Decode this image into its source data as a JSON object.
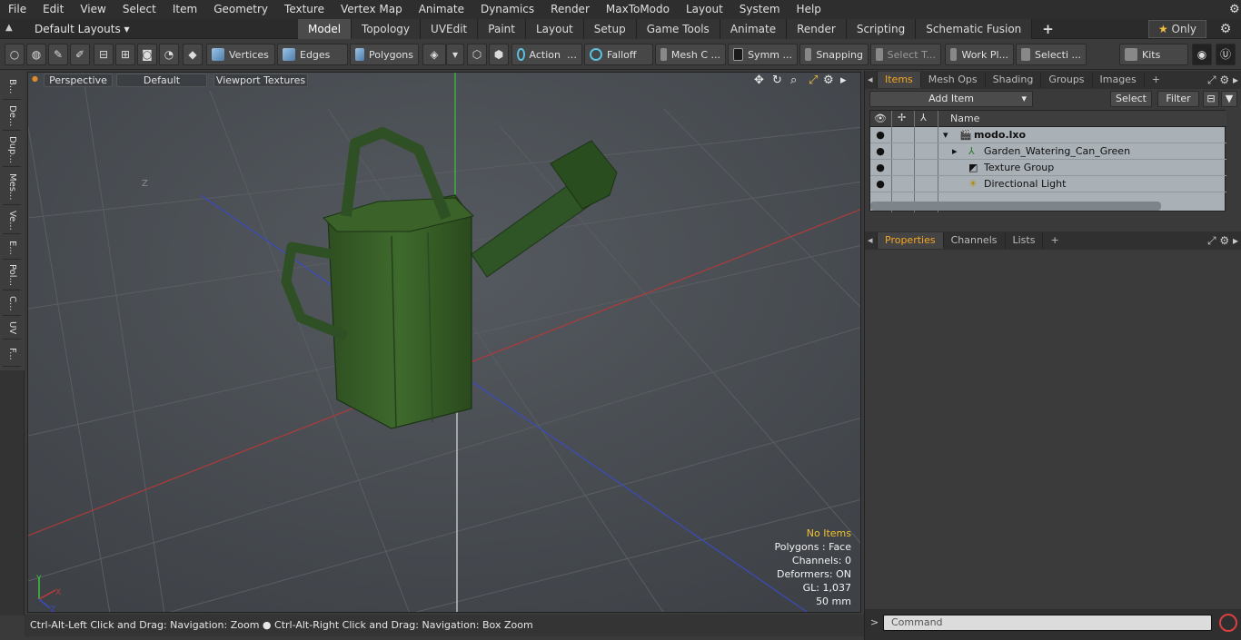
{
  "menubar": {
    "items": [
      "File",
      "Edit",
      "View",
      "Select",
      "Item",
      "Geometry",
      "Texture",
      "Vertex Map",
      "Animate",
      "Dynamics",
      "Render",
      "MaxToModo",
      "Layout",
      "System",
      "Help"
    ]
  },
  "layoutbar": {
    "layout_label": "Default Layouts",
    "tabs": [
      "Model",
      "Topology",
      "UVEdit",
      "Paint",
      "Layout",
      "Setup",
      "Game Tools",
      "Animate",
      "Render",
      "Scripting",
      "Schematic Fusion"
    ],
    "active_tab": "Model",
    "add_tab": "+",
    "only_label": "Only"
  },
  "toolbar": {
    "vertices": "Vertices",
    "edges": "Edges",
    "polygons": "Polygons",
    "action": "Action",
    "falloff": "Falloff",
    "mesh_c": "Mesh C ...",
    "symm": "Symm ...",
    "snapping": "Snapping",
    "select_t": "Select T...",
    "work_pl": "Work Pl...",
    "selecti": "Selecti ...",
    "kits": "Kits"
  },
  "leftstrip": {
    "tabs": [
      "B...",
      "De...",
      "Dup...",
      "Mes...",
      "Ve...",
      "E...",
      "Pol...",
      "C...",
      "UV",
      "F..."
    ]
  },
  "viewport": {
    "view_mode": "Perspective",
    "style": "Default",
    "textures": "Viewport Textures",
    "info": {
      "no_items": "No Items",
      "polygons": "Polygons : Face",
      "channels": "Channels: 0",
      "deformers": "Deformers: ON",
      "gl": "GL: 1,037",
      "size": "50 mm"
    },
    "axis_z_label": "Z",
    "axis_y": "Y",
    "axis_x": "X",
    "axis_z": "Z"
  },
  "statusbar": {
    "left": "Ctrl-Alt-Left Click and Drag: Navigation: Zoom",
    "right": "Ctrl-Alt-Right Click and Drag: Navigation: Box Zoom"
  },
  "items_panel": {
    "tabs": [
      "Items",
      "Mesh Ops",
      "Shading",
      "Groups",
      "Images"
    ],
    "active_tab": "Items",
    "add_item": "Add Item",
    "select_btn": "Select",
    "filter_btn": "Filter",
    "column_name": "Name",
    "rows": [
      {
        "name": "modo.lxo",
        "bold": true
      },
      {
        "name": "Garden_Watering_Can_Green"
      },
      {
        "name": "Texture Group"
      },
      {
        "name": "Directional Light"
      }
    ]
  },
  "properties_panel": {
    "tabs": [
      "Properties",
      "Channels",
      "Lists"
    ],
    "active_tab": "Properties"
  },
  "command": {
    "placeholder": "Command",
    "prompt": ">"
  }
}
